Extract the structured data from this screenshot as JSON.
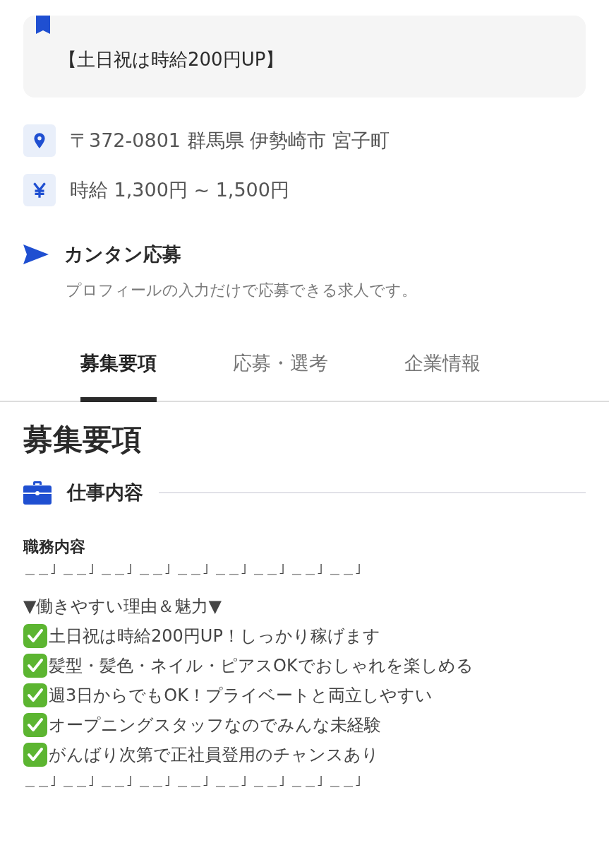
{
  "highlight": {
    "text": "【土日祝は時給200円UP】"
  },
  "info": [
    {
      "kind": "location",
      "text": "〒372-0801 群馬県 伊勢崎市 宮子町"
    },
    {
      "kind": "wage",
      "text": "時給 1,300円 ~ 1,500円"
    }
  ],
  "easy_apply": {
    "title": "カンタン応募",
    "description": "プロフィールの入力だけで応募できる求人です。"
  },
  "tabs": [
    {
      "label": "募集要項",
      "selected": true
    },
    {
      "label": "応募・選考",
      "selected": false
    },
    {
      "label": "企業情報",
      "selected": false
    }
  ],
  "heading": "募集要項",
  "section": {
    "title": "仕事内容",
    "subtitle": "職務内容",
    "lines": [
      {
        "kind": "divider",
        "text": "＿＿｣ ＿＿｣ ＿＿｣ ＿＿｣ ＿＿｣ ＿＿｣ ＿＿｣ ＿＿｣ ＿＿｣"
      },
      {
        "kind": "plain",
        "text": "▼働きやすい理由＆魅力▼"
      },
      {
        "kind": "check",
        "text": "土日祝は時給200円UP！しっかり稼げます"
      },
      {
        "kind": "check",
        "text": "髪型・髪色・ネイル・ピアスOKでおしゃれを楽しめる"
      },
      {
        "kind": "check",
        "text": "週3日からでもOK！プライベートと両立しやすい"
      },
      {
        "kind": "check",
        "text": "オープニングスタッフなのでみんな未経験"
      },
      {
        "kind": "check",
        "text": "がんばり次第で正社員登用のチャンスあり"
      },
      {
        "kind": "divider",
        "text": "＿＿｣ ＿＿｣ ＿＿｣ ＿＿｣ ＿＿｣ ＿＿｣ ＿＿｣ ＿＿｣ ＿＿｣"
      }
    ]
  }
}
